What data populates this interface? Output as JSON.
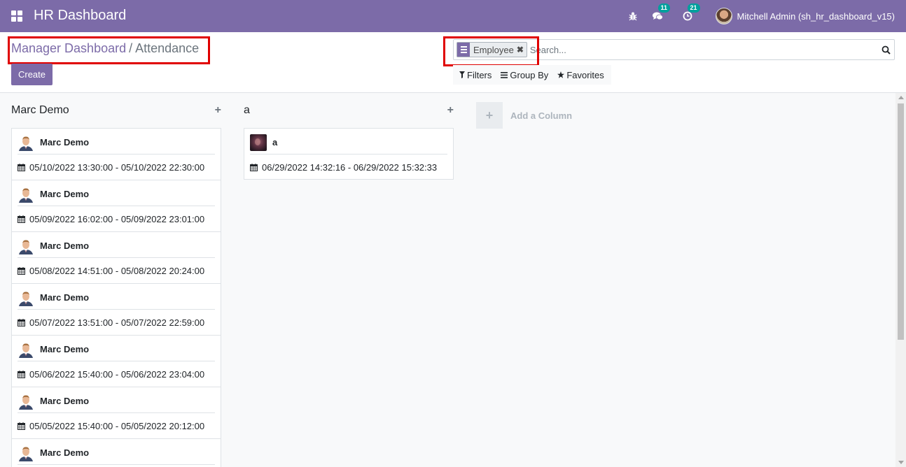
{
  "navbar": {
    "app_title": "HR Dashboard",
    "messages_count": "11",
    "activities_count": "21",
    "user_name": "Mitchell Admin (sh_hr_dashboard_v15)"
  },
  "breadcrumb": {
    "parent": "Manager Dashboard",
    "separator": "/",
    "current": "Attendance"
  },
  "create_label": "Create",
  "search": {
    "facet_label": "Employee",
    "placeholder": "Search..."
  },
  "search_options": {
    "filters": "Filters",
    "group_by": "Group By",
    "favorites": "Favorites"
  },
  "columns": [
    {
      "title": "Marc Demo",
      "cards": [
        {
          "name": "Marc Demo",
          "time": "05/10/2022 13:30:00 - 05/10/2022 22:30:00"
        },
        {
          "name": "Marc Demo",
          "time": "05/09/2022 16:02:00 - 05/09/2022 23:01:00"
        },
        {
          "name": "Marc Demo",
          "time": "05/08/2022 14:51:00 - 05/08/2022 20:24:00"
        },
        {
          "name": "Marc Demo",
          "time": "05/07/2022 13:51:00 - 05/07/2022 22:59:00"
        },
        {
          "name": "Marc Demo",
          "time": "05/06/2022 15:40:00 - 05/06/2022 23:04:00"
        },
        {
          "name": "Marc Demo",
          "time": "05/05/2022 15:40:00 - 05/05/2022 20:12:00"
        },
        {
          "name": "Marc Demo",
          "time": ""
        }
      ]
    },
    {
      "title": "a",
      "cards": [
        {
          "name": "a",
          "time": "06/29/2022 14:32:16 - 06/29/2022 15:32:33"
        }
      ]
    }
  ],
  "add_column_label": "Add a Column",
  "colors": {
    "brand": "#7c6ba8",
    "badge": "#00a09d",
    "highlight_box": "#e00000"
  }
}
